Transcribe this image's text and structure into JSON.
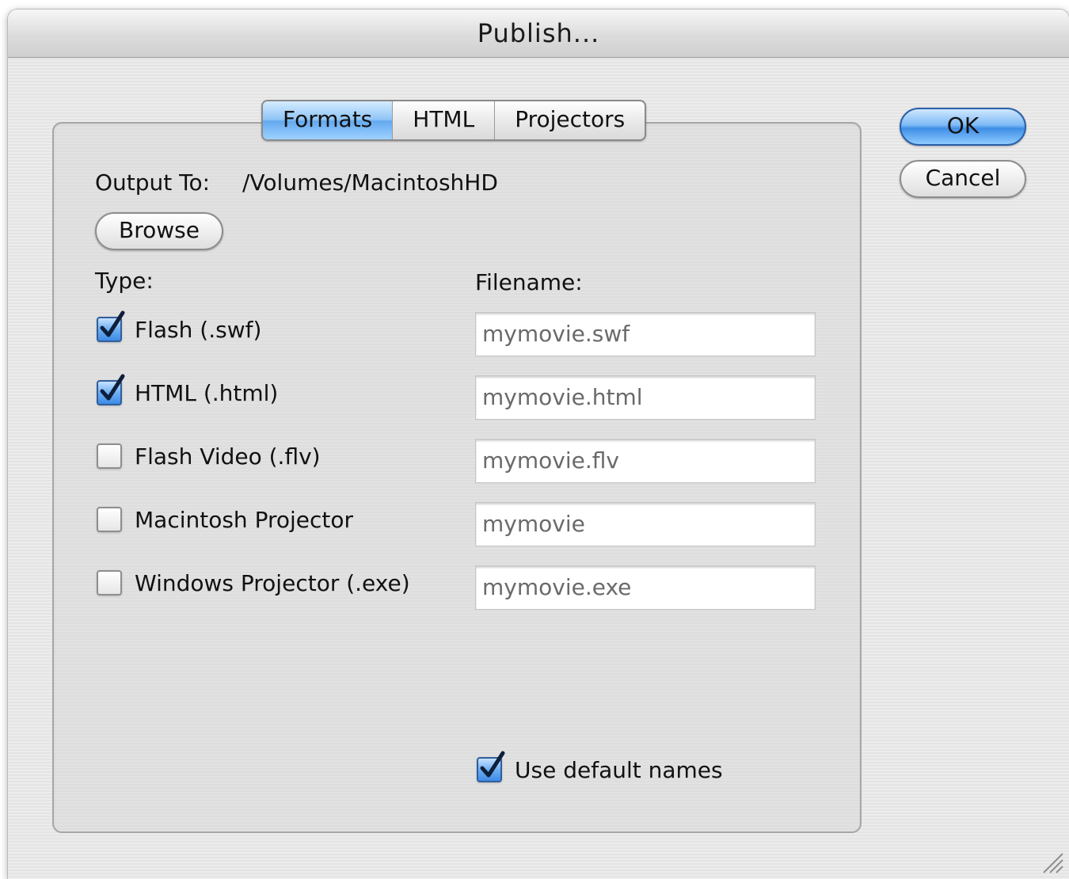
{
  "window": {
    "title": "Publish..."
  },
  "tabs": [
    {
      "label": "Formats",
      "active": true
    },
    {
      "label": "HTML",
      "active": false
    },
    {
      "label": "Projectors",
      "active": false
    }
  ],
  "buttons": {
    "ok": "OK",
    "cancel": "Cancel",
    "browse": "Browse"
  },
  "output": {
    "label": "Output To:",
    "path": "/Volumes/MacintoshHD"
  },
  "headers": {
    "type": "Type:",
    "filename": "Filename:"
  },
  "formats": [
    {
      "label": "Flash (.swf)",
      "checked": true,
      "filename": "mymovie.swf"
    },
    {
      "label": "HTML (.html)",
      "checked": true,
      "filename": "mymovie.html"
    },
    {
      "label": "Flash Video (.flv)",
      "checked": false,
      "filename": "mymovie.flv"
    },
    {
      "label": "Macintosh Projector",
      "checked": false,
      "filename": "mymovie"
    },
    {
      "label": "Windows Projector (.exe)",
      "checked": false,
      "filename": "mymovie.exe"
    }
  ],
  "default_names": {
    "label": "Use default names",
    "checked": true
  },
  "colors": {
    "accent": "#64a9ef",
    "check_blue": "#3d8be6",
    "default_button": "#3f8ee6"
  },
  "icons": {
    "check": "checkmark-icon",
    "resize": "resize-grip-icon"
  }
}
